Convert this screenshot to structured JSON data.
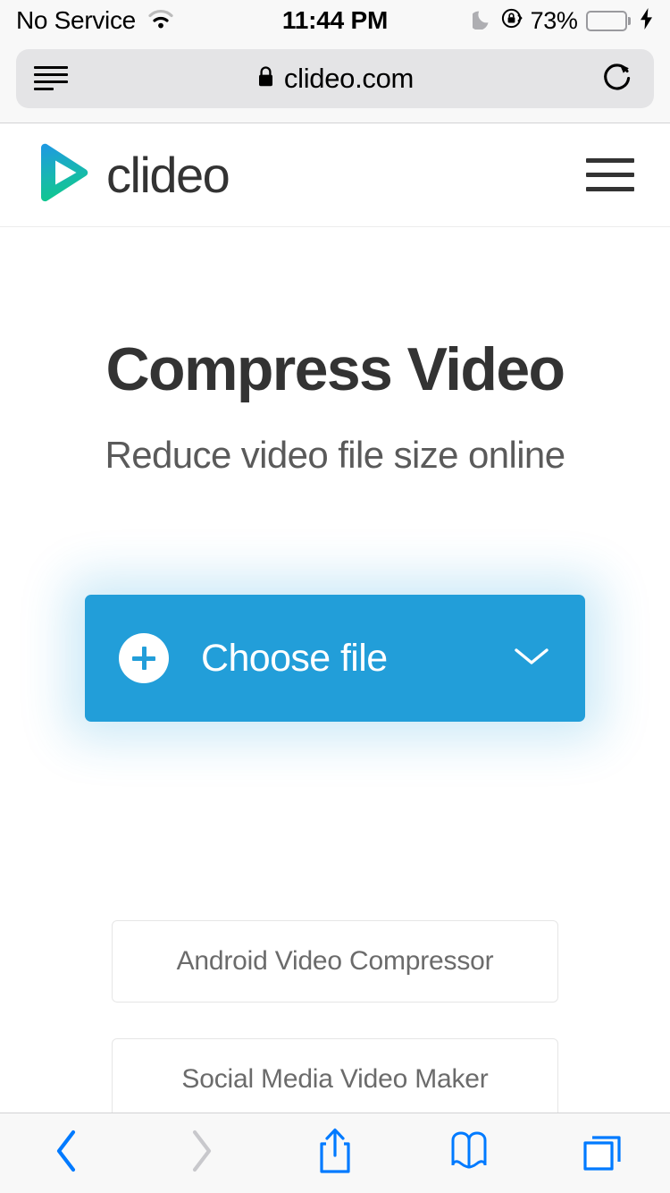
{
  "status_bar": {
    "carrier": "No Service",
    "wifi_icon": "wifi-icon",
    "time": "11:44 PM",
    "dnd_icon": "moon-icon",
    "rotation_lock_icon": "rotation-lock-icon",
    "battery_percent": "73%",
    "battery_level": 73,
    "battery_color": "#4cd964",
    "charging_icon": "lightning-bolt-icon"
  },
  "browser": {
    "reader_icon": "reader-view-icon",
    "lock_icon": "lock-icon",
    "url": "clideo.com",
    "reload_icon": "reload-icon",
    "toolbar": {
      "back_label": "back-chevron-icon",
      "forward_label": "forward-chevron-icon",
      "share_label": "share-icon",
      "bookmarks_label": "bookmarks-book-icon",
      "tabs_label": "tabs-icon",
      "back_enabled": true,
      "forward_enabled": false,
      "accent_color": "#007AFF",
      "disabled_color": "#c8c8cc"
    }
  },
  "site_header": {
    "logo_icon": "clideo-play-logo-icon",
    "brand_name": "clideo",
    "logo_gradient_start": "#1e9ae0",
    "logo_gradient_end": "#0ec98a",
    "menu_icon": "hamburger-menu-icon"
  },
  "hero": {
    "title": "Compress Video",
    "subtitle": "Reduce video file size online"
  },
  "cta": {
    "plus_icon": "plus-circle-icon",
    "label": "Choose file",
    "chevron_icon": "chevron-down-icon",
    "background_color": "#229ed9"
  },
  "link_cards": [
    {
      "label": "Android Video Compressor"
    },
    {
      "label": "Social Media Video Maker"
    }
  ]
}
